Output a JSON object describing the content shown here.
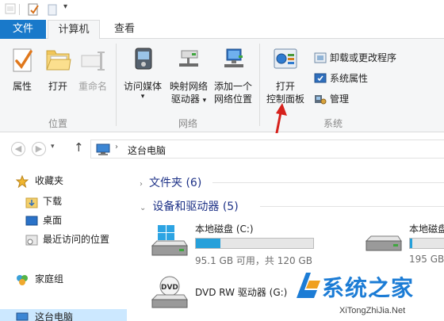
{
  "tabs": {
    "file": "文件",
    "computer": "计算机",
    "view": "查看"
  },
  "ribbon": {
    "groups": [
      {
        "label": "位置",
        "buttons": [
          "属性",
          "打开",
          "重命名"
        ]
      },
      {
        "label": "网络",
        "buttons": [
          "访问媒体",
          "映射网络\n驱动器",
          "添加一个\n网络位置"
        ]
      },
      {
        "label": "系统",
        "buttons": [
          "打开\n控制面板"
        ],
        "small": [
          "卸载或更改程序",
          "系统属性",
          "管理"
        ]
      }
    ],
    "b": {
      "properties": "属性",
      "open": "打开",
      "rename": "重命名",
      "media_1": "访问媒体",
      "map_1": "映射网络",
      "map_2": "驱动器",
      "addnet_1": "添加一个",
      "addnet_2": "网络位置",
      "cp_1": "打开",
      "cp_2": "控制面板",
      "uninstall": "卸载或更改程序",
      "sysprops": "系统属性",
      "manage": "管理",
      "g1": "位置",
      "g2": "网络",
      "g3": "系统"
    }
  },
  "address": {
    "location": "这台电脑"
  },
  "nav": {
    "favorites": "收藏夹",
    "downloads": "下载",
    "desktop": "桌面",
    "recent": "最近访问的位置",
    "homegroup": "家庭组",
    "thispc": "这台电脑"
  },
  "content": {
    "folders": "文件夹 (6)",
    "devices": "设备和驱动器 (5)",
    "drives": [
      {
        "name": "本地磁盘 (C:)",
        "sub": "95.1 GB 可用，共 120 GB",
        "used_fraction": 0.21
      },
      {
        "name": "本地磁盘",
        "sub": "195 GB",
        "used_fraction": 0.05
      },
      {
        "name": "DVD RW 驱动器 (G:)",
        "sub": ""
      }
    ]
  },
  "watermark": {
    "title": "系统之家",
    "url": "XiTongZhiJia.Net"
  },
  "colors": {
    "accent": "#1979ca",
    "ribbon_bg": "#f5f6f7",
    "bar_fill": "#26a0da",
    "arrow": "#d6211c"
  }
}
